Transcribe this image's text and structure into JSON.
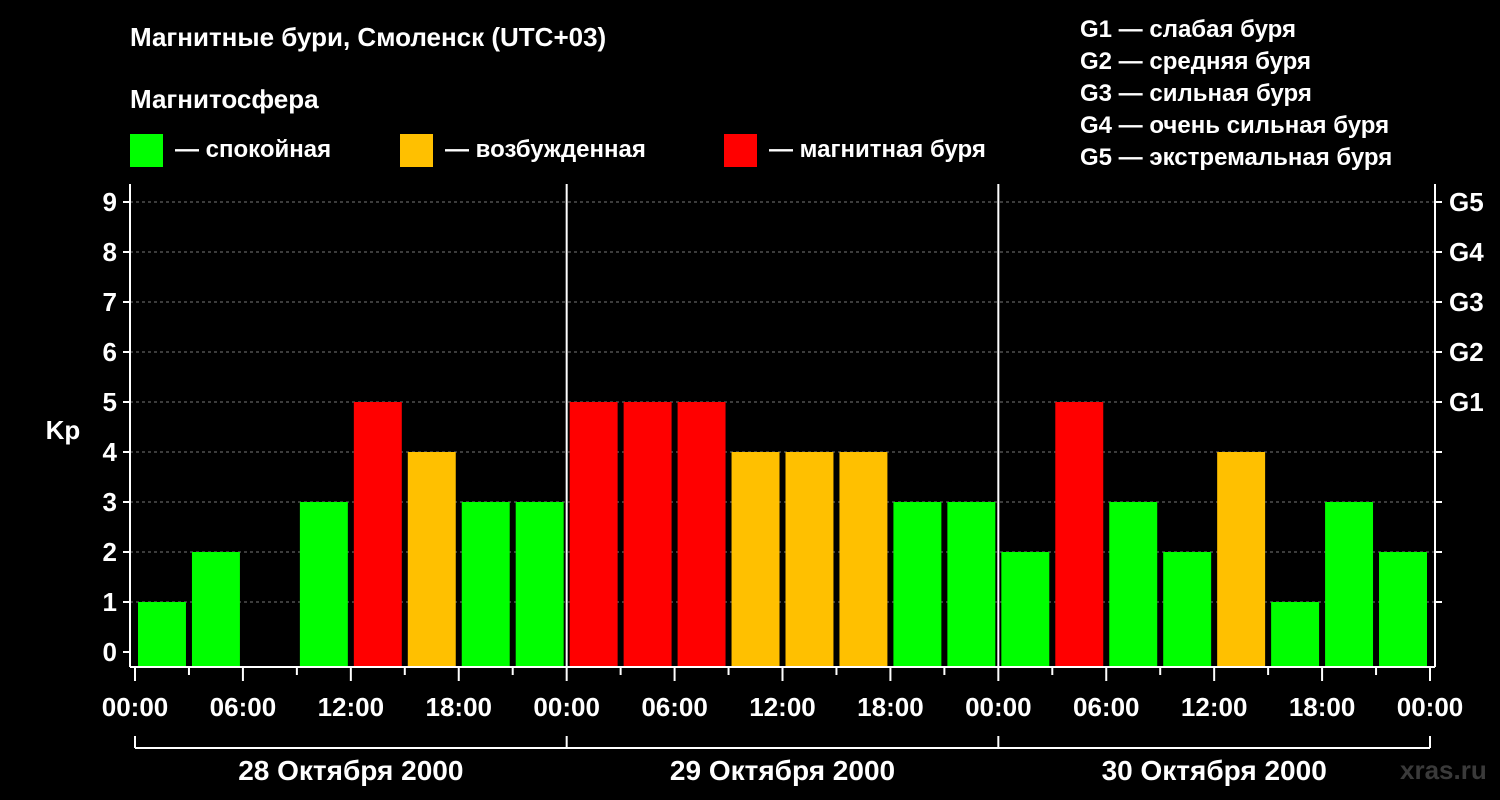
{
  "title": "Магнитные бури, Смоленск (UTC+03)",
  "subtitle": "Магнитосфера",
  "legend": [
    {
      "label": "— спокойная",
      "color": "#00ff00"
    },
    {
      "label": "— возбужденная",
      "color": "#ffc000"
    },
    {
      "label": "— магнитная буря",
      "color": "#ff0000"
    }
  ],
  "g_legend": [
    "G1 — слабая буря",
    "G2 — средняя буря",
    "G3 — сильная буря",
    "G4 — очень сильная буря",
    "G5 — экстремальная буря"
  ],
  "watermark": "xras.ru",
  "chart_data": {
    "type": "bar",
    "ylabel": "Kp",
    "ylim": [
      0,
      9
    ],
    "y_ticks": [
      0,
      1,
      2,
      3,
      4,
      5,
      6,
      7,
      8,
      9
    ],
    "right_ticks": [
      {
        "value": 5,
        "label": "G1"
      },
      {
        "value": 6,
        "label": "G2"
      },
      {
        "value": 7,
        "label": "G3"
      },
      {
        "value": 8,
        "label": "G4"
      },
      {
        "value": 9,
        "label": "G5"
      }
    ],
    "x_tick_labels": [
      "00:00",
      "06:00",
      "12:00",
      "18:00",
      "00:00",
      "06:00",
      "12:00",
      "18:00",
      "00:00",
      "06:00",
      "12:00",
      "18:00",
      "00:00"
    ],
    "days": [
      "28 Октября 2000",
      "29 Октября 2000",
      "30 Октября 2000"
    ],
    "interval_hours": 3,
    "grid": "horizontal dashed",
    "values": [
      1,
      2,
      0,
      3,
      5,
      4,
      3,
      3,
      5,
      5,
      5,
      4,
      4,
      4,
      3,
      3,
      2,
      5,
      3,
      2,
      4,
      1,
      3,
      2
    ],
    "color_rules": {
      "quiet_max": 3,
      "active_value": 4,
      "storm_min": 5
    }
  }
}
